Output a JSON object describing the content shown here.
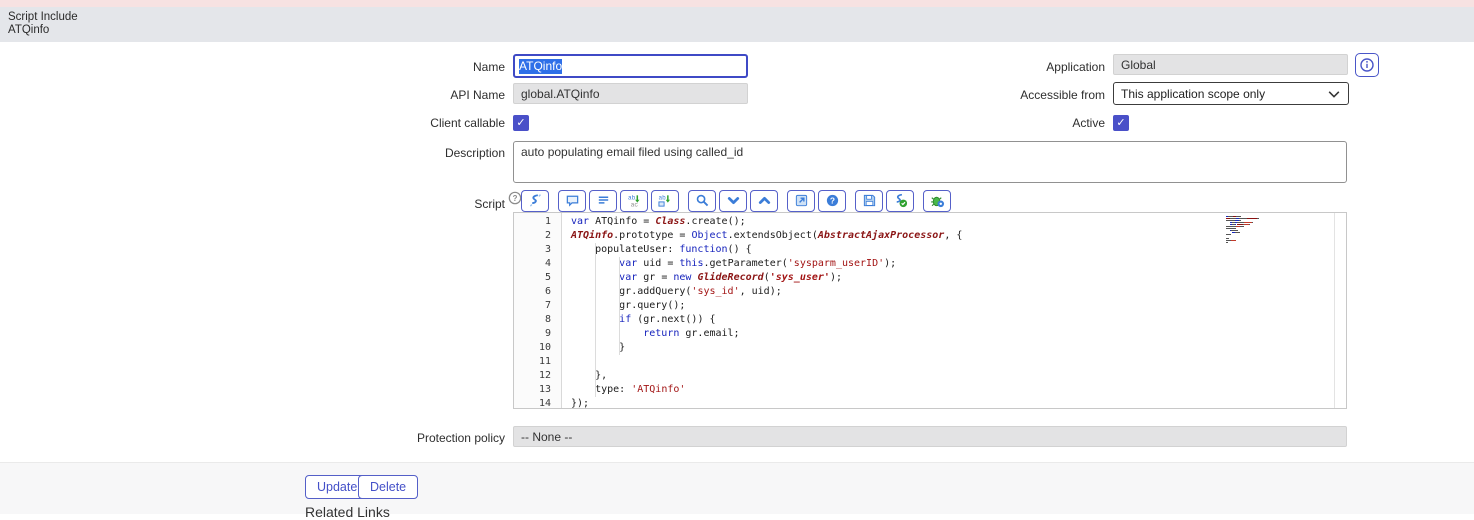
{
  "header": {
    "record_type": "Script Include",
    "record_name": "ATQinfo"
  },
  "form": {
    "name": {
      "label": "Name",
      "value": "ATQinfo"
    },
    "api_name": {
      "label": "API Name",
      "value": "global.ATQinfo"
    },
    "client_callable": {
      "label": "Client callable",
      "checked": true
    },
    "application": {
      "label": "Application",
      "value": "Global"
    },
    "accessible_from": {
      "label": "Accessible from",
      "value": "This application scope only"
    },
    "active": {
      "label": "Active",
      "checked": true
    },
    "description": {
      "label": "Description",
      "value": "auto populating email filed using called_id"
    },
    "script": {
      "label": "Script"
    },
    "protection_policy": {
      "label": "Protection policy",
      "value": "-- None --"
    }
  },
  "toolbar": {
    "groups": [
      [
        {
          "name": "toggle-syntax-editor-button",
          "icon": "syntax-editor-icon"
        }
      ],
      [
        {
          "name": "comment-code-button",
          "icon": "comment-icon"
        },
        {
          "name": "format-code-button",
          "icon": "format-lines-icon"
        },
        {
          "name": "replace-button",
          "icon": "replace-icon"
        },
        {
          "name": "replace-all-button",
          "icon": "replace-all-icon"
        }
      ],
      [
        {
          "name": "search-button",
          "icon": "search-icon"
        },
        {
          "name": "find-next-button",
          "icon": "chevron-down-icon"
        },
        {
          "name": "find-previous-button",
          "icon": "chevron-up-icon"
        }
      ],
      [
        {
          "name": "fullscreen-button",
          "icon": "popout-icon"
        },
        {
          "name": "editor-help-button",
          "icon": "help-icon"
        }
      ],
      [
        {
          "name": "save-button",
          "icon": "save-icon"
        },
        {
          "name": "syntax-check-button",
          "icon": "syntax-check-icon"
        }
      ],
      [
        {
          "name": "debugger-button",
          "icon": "debug-icon"
        }
      ]
    ]
  },
  "editor": {
    "lines": [
      [
        {
          "t": "var ",
          "c": "k"
        },
        {
          "t": "ATQinfo = ",
          "c": ""
        },
        {
          "t": "Class",
          "c": "c"
        },
        {
          "t": ".create();",
          "c": ""
        }
      ],
      [
        {
          "t": "ATQinfo",
          "c": "c"
        },
        {
          "t": ".prototype = ",
          "c": ""
        },
        {
          "t": "Object",
          "c": "k"
        },
        {
          "t": ".extendsObject(",
          "c": ""
        },
        {
          "t": "AbstractAjaxProcessor",
          "c": "c"
        },
        {
          "t": ", {",
          "c": ""
        }
      ],
      [
        {
          "t": "    populateUser: ",
          "c": ""
        },
        {
          "t": "function",
          "c": "k"
        },
        {
          "t": "() {",
          "c": ""
        }
      ],
      [
        {
          "t": "        ",
          "c": ""
        },
        {
          "t": "var",
          "c": "k"
        },
        {
          "t": " uid = ",
          "c": ""
        },
        {
          "t": "this",
          "c": "k"
        },
        {
          "t": ".getParameter(",
          "c": ""
        },
        {
          "t": "'sysparm_userID'",
          "c": "s"
        },
        {
          "t": ");",
          "c": ""
        }
      ],
      [
        {
          "t": "        ",
          "c": ""
        },
        {
          "t": "var",
          "c": "k"
        },
        {
          "t": " gr = ",
          "c": ""
        },
        {
          "t": "new",
          "c": "k"
        },
        {
          "t": " ",
          "c": ""
        },
        {
          "t": "GlideRecord",
          "c": "c"
        },
        {
          "t": "(",
          "c": ""
        },
        {
          "t": "'sys_user'",
          "c": "si"
        },
        {
          "t": ");",
          "c": ""
        }
      ],
      [
        {
          "t": "        gr.addQuery(",
          "c": ""
        },
        {
          "t": "'sys_id'",
          "c": "s"
        },
        {
          "t": ", uid);",
          "c": ""
        }
      ],
      [
        {
          "t": "        gr.query();",
          "c": ""
        }
      ],
      [
        {
          "t": "        ",
          "c": ""
        },
        {
          "t": "if",
          "c": "k"
        },
        {
          "t": " (gr.next()) {",
          "c": ""
        }
      ],
      [
        {
          "t": "            ",
          "c": ""
        },
        {
          "t": "return",
          "c": "k"
        },
        {
          "t": " gr.email;",
          "c": ""
        }
      ],
      [
        {
          "t": "        }",
          "c": ""
        }
      ],
      [],
      [
        {
          "t": "    },",
          "c": ""
        }
      ],
      [
        {
          "t": "    type: ",
          "c": ""
        },
        {
          "t": "'ATQinfo'",
          "c": "s"
        }
      ],
      [
        {
          "t": "});",
          "c": ""
        }
      ]
    ]
  },
  "footer": {
    "update_label": "Update",
    "delete_label": "Delete",
    "related_links_label": "Related Links"
  },
  "colors": {
    "accent_indigo": "#4a50c8",
    "selection_blue": "#2e6fe8",
    "header_bg": "#e4e6ea",
    "notification_strip": "#f7e2e2",
    "keyword": "#1724bd",
    "classname": "#8b1515",
    "string": "#a31515",
    "toolbar_icon_blue": "#3b7dd8",
    "toolbar_icon_green": "#2fa12f"
  }
}
